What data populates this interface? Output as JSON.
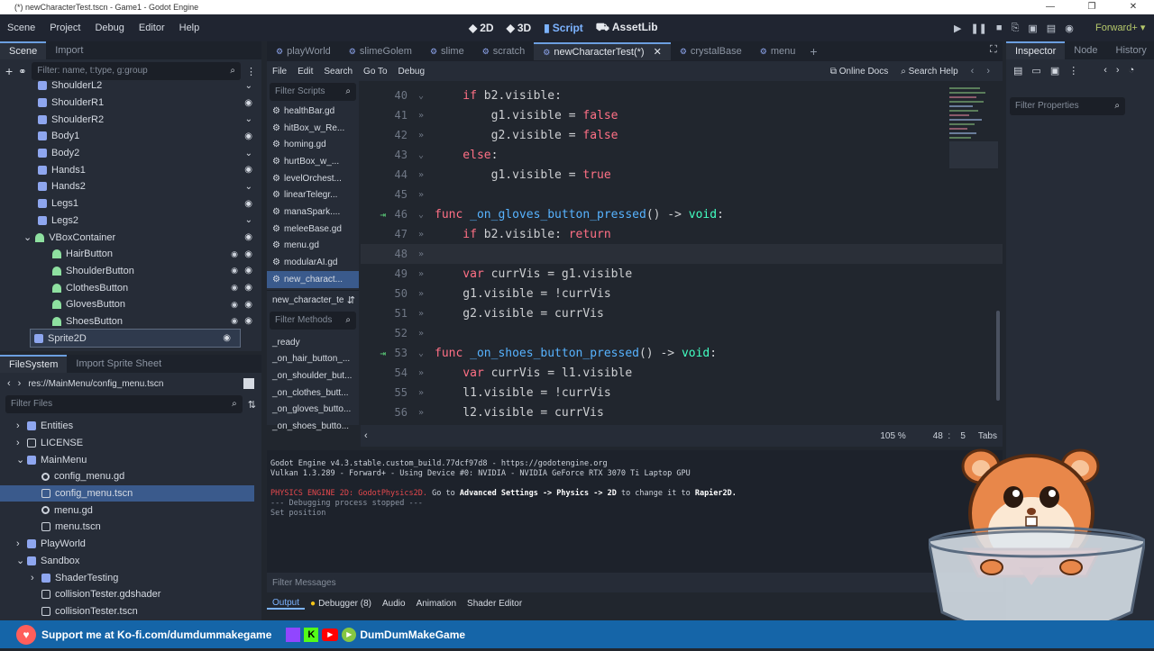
{
  "window": {
    "title": "(*) newCharacterTest.tscn - Game1 - Godot Engine"
  },
  "menu": [
    "Scene",
    "Project",
    "Debug",
    "Editor",
    "Help"
  ],
  "modes": [
    {
      "label": "2D",
      "icon": "viewport-2d-icon"
    },
    {
      "label": "3D",
      "icon": "viewport-3d-icon"
    },
    {
      "label": "Script",
      "icon": "script-icon",
      "active": true
    },
    {
      "label": "AssetLib",
      "icon": "assetlib-icon"
    }
  ],
  "renderer": "Forward+",
  "scene_panel": {
    "tabs": [
      "Scene",
      "Import"
    ],
    "filter_placeholder": "Filter: name, t:type, g:group",
    "nodes": [
      {
        "label": "ShoulderL2",
        "indent": 2,
        "icon": "node",
        "status": "fold"
      },
      {
        "label": "ShoulderR1",
        "indent": 2,
        "icon": "node",
        "status": "eye"
      },
      {
        "label": "ShoulderR2",
        "indent": 2,
        "icon": "node",
        "status": "fold"
      },
      {
        "label": "Body1",
        "indent": 2,
        "icon": "node",
        "status": "eye"
      },
      {
        "label": "Body2",
        "indent": 2,
        "icon": "node",
        "status": "fold"
      },
      {
        "label": "Hands1",
        "indent": 2,
        "icon": "node",
        "status": "eye"
      },
      {
        "label": "Hands2",
        "indent": 2,
        "icon": "node",
        "status": "fold"
      },
      {
        "label": "Legs1",
        "indent": 2,
        "icon": "node",
        "status": "eye"
      },
      {
        "label": "Legs2",
        "indent": 2,
        "icon": "node",
        "status": "fold"
      },
      {
        "label": "VBoxContainer",
        "indent": 1,
        "icon": "ctrl",
        "status": "eye",
        "expander": "⌄"
      },
      {
        "label": "HairButton",
        "indent": 3,
        "icon": "ctrl",
        "status": "eye",
        "signal": true
      },
      {
        "label": "ShoulderButton",
        "indent": 3,
        "icon": "ctrl",
        "status": "eye",
        "signal": true
      },
      {
        "label": "ClothesButton",
        "indent": 3,
        "icon": "ctrl",
        "status": "eye",
        "signal": true
      },
      {
        "label": "GlovesButton",
        "indent": 3,
        "icon": "ctrl",
        "status": "eye",
        "signal": true
      },
      {
        "label": "ShoesButton",
        "indent": 3,
        "icon": "ctrl",
        "status": "eye",
        "signal": true
      },
      {
        "label": "Sprite2D",
        "indent": 0,
        "icon": "node",
        "status": "eye",
        "selected": true
      }
    ]
  },
  "filesystem_panel": {
    "tabs": [
      "FileSystem",
      "Import Sprite Sheet"
    ],
    "path": "res://MainMenu/config_menu.tscn",
    "filter_placeholder": "Filter Files",
    "items": [
      {
        "label": "Entities",
        "indent": 0,
        "icon": "folder",
        "expander": "›"
      },
      {
        "label": "LICENSE",
        "indent": 0,
        "icon": "scene",
        "expander": "›"
      },
      {
        "label": "MainMenu",
        "indent": 0,
        "icon": "folder",
        "expander": "⌄"
      },
      {
        "label": "config_menu.gd",
        "indent": 1,
        "icon": "gear"
      },
      {
        "label": "config_menu.tscn",
        "indent": 1,
        "icon": "scene",
        "selected": true
      },
      {
        "label": "menu.gd",
        "indent": 1,
        "icon": "gear"
      },
      {
        "label": "menu.tscn",
        "indent": 1,
        "icon": "scene"
      },
      {
        "label": "PlayWorld",
        "indent": 0,
        "icon": "folder",
        "expander": "›"
      },
      {
        "label": "Sandbox",
        "indent": 0,
        "icon": "folder",
        "expander": "⌄"
      },
      {
        "label": "ShaderTesting",
        "indent": 1,
        "icon": "folder",
        "expander": "›"
      },
      {
        "label": "collisionTester.gdshader",
        "indent": 1,
        "icon": "scene"
      },
      {
        "label": "collisionTester.tscn",
        "indent": 1,
        "icon": "scene"
      }
    ]
  },
  "editor_tabs": [
    {
      "label": "playWorld",
      "icon": "scene"
    },
    {
      "label": "slimeGolem",
      "icon": "scene"
    },
    {
      "label": "slime",
      "icon": "scene"
    },
    {
      "label": "scratch",
      "icon": "scene"
    },
    {
      "label": "newCharacterTest(*)",
      "icon": "scene",
      "active": true
    },
    {
      "label": "crystalBase",
      "icon": "scene"
    },
    {
      "label": "menu",
      "icon": "scene"
    }
  ],
  "script_menu": [
    "File",
    "Edit",
    "Search",
    "Go To",
    "Debug"
  ],
  "online_docs": "Online Docs",
  "search_help": "Search Help",
  "scripts": {
    "filter_placeholder": "Filter Scripts",
    "list": [
      "healthBar.gd",
      "hitBox_w_Re...",
      "homing.gd",
      "hurtBox_w_...",
      "levelOrchest...",
      "linearTelegr...",
      "manaSpark....",
      "meleeBase.gd",
      "menu.gd",
      "modularAI.gd",
      "new_charact..."
    ],
    "current_script": "new_character_te",
    "methods_placeholder": "Filter Methods",
    "methods": [
      "_ready",
      "_on_hair_button_...",
      "_on_shoulder_but...",
      "_on_clothes_butt...",
      "_on_gloves_butto...",
      "_on_shoes_butto..."
    ]
  },
  "code": [
    {
      "num": "40",
      "fold": true,
      "tokens": [
        [
          "kw",
          "    if "
        ],
        [
          "tx",
          "b2.visible:"
        ]
      ]
    },
    {
      "num": "41",
      "tokens": [
        [
          "tx",
          "        g1.visible = "
        ],
        [
          "kw",
          "false"
        ]
      ]
    },
    {
      "num": "42",
      "tokens": [
        [
          "tx",
          "        g2.visible = "
        ],
        [
          "kw",
          "false"
        ]
      ]
    },
    {
      "num": "43",
      "fold": true,
      "tokens": [
        [
          "kw",
          "    else"
        ],
        [
          "tx",
          ":"
        ]
      ]
    },
    {
      "num": "44",
      "tokens": [
        [
          "tx",
          "        g1.visible = "
        ],
        [
          "kw",
          "true"
        ]
      ]
    },
    {
      "num": "45",
      "tokens": []
    },
    {
      "num": "46",
      "signal": true,
      "fold": true,
      "tokens": [
        [
          "kw",
          "func "
        ],
        [
          "fn",
          "_on_gloves_button_pressed"
        ],
        [
          "tx",
          "() -> "
        ],
        [
          "ty",
          "void"
        ],
        [
          "tx",
          ":"
        ]
      ]
    },
    {
      "num": "47",
      "tokens": [
        [
          "kw",
          "    if "
        ],
        [
          "tx",
          "b2.visible: "
        ],
        [
          "kw",
          "return"
        ]
      ]
    },
    {
      "num": "48",
      "current": true,
      "tokens": []
    },
    {
      "num": "49",
      "tokens": [
        [
          "kw",
          "    var "
        ],
        [
          "tx",
          "currVis = g1.visible"
        ]
      ]
    },
    {
      "num": "50",
      "tokens": [
        [
          "tx",
          "    g1.visible = !currVis"
        ]
      ]
    },
    {
      "num": "51",
      "tokens": [
        [
          "tx",
          "    g2.visible = currVis"
        ]
      ]
    },
    {
      "num": "52",
      "tokens": []
    },
    {
      "num": "53",
      "signal": true,
      "fold": true,
      "tokens": [
        [
          "kw",
          "func "
        ],
        [
          "fn",
          "_on_shoes_button_pressed"
        ],
        [
          "tx",
          "() -> "
        ],
        [
          "ty",
          "void"
        ],
        [
          "tx",
          ":"
        ]
      ]
    },
    {
      "num": "54",
      "tokens": [
        [
          "kw",
          "    var "
        ],
        [
          "tx",
          "currVis = l1.visible"
        ]
      ]
    },
    {
      "num": "55",
      "tokens": [
        [
          "tx",
          "    l1.visible = !currVis"
        ]
      ]
    },
    {
      "num": "56",
      "tokens": [
        [
          "tx",
          "    l2.visible = currVis"
        ]
      ]
    }
  ],
  "status": {
    "zoom": "105 %",
    "line": "48",
    "col_sep": ":",
    "col": "5",
    "indent": "Tabs"
  },
  "output": {
    "lines": [
      {
        "parts": [
          [
            "#cdd3dc",
            "Godot Engine v4.3.stable.custom_build.77dcf97d8 - https://godotengine.org"
          ]
        ]
      },
      {
        "parts": [
          [
            "#cdd3dc",
            "Vulkan 1.3.289 - Forward+ - Using Device #0: NVIDIA - NVIDIA GeForce RTX 3070 Ti Laptop GPU"
          ]
        ]
      },
      {
        "parts": []
      },
      {
        "parts": [
          [
            "#e5484d",
            "PHYSICS ENGINE 2D: GodotPhysics2D."
          ],
          [
            "#cdd3dc",
            " Go to "
          ],
          [
            "#ffffff",
            "Advanced Settings -> Physics -> 2D"
          ],
          [
            "#cdd3dc",
            " to change it to "
          ],
          [
            "#ffffff",
            "Rapier2D."
          ]
        ]
      },
      {
        "parts": [
          [
            "#8d96a4",
            "--- Debugging process stopped ---"
          ]
        ]
      },
      {
        "parts": [
          [
            "#8d96a4",
            "Set position"
          ]
        ]
      }
    ],
    "filter_placeholder": "Filter Messages"
  },
  "bottom_tabs": [
    "Output",
    "Debugger (8)",
    "Audio",
    "Animation",
    "Shader Editor"
  ],
  "inspector": {
    "tabs": [
      "Inspector",
      "Node",
      "History"
    ],
    "filter_placeholder": "Filter Properties"
  },
  "banner": {
    "kofi_text": "Support me at Ko-fi.com/dumdummakegame",
    "channel_name": "DumDumMakeGame"
  },
  "colors": {
    "accent": "#6c9fe0",
    "banner": "#1565a8",
    "keyword": "#ff7085",
    "function": "#57b3ff",
    "type": "#42ffc2"
  }
}
